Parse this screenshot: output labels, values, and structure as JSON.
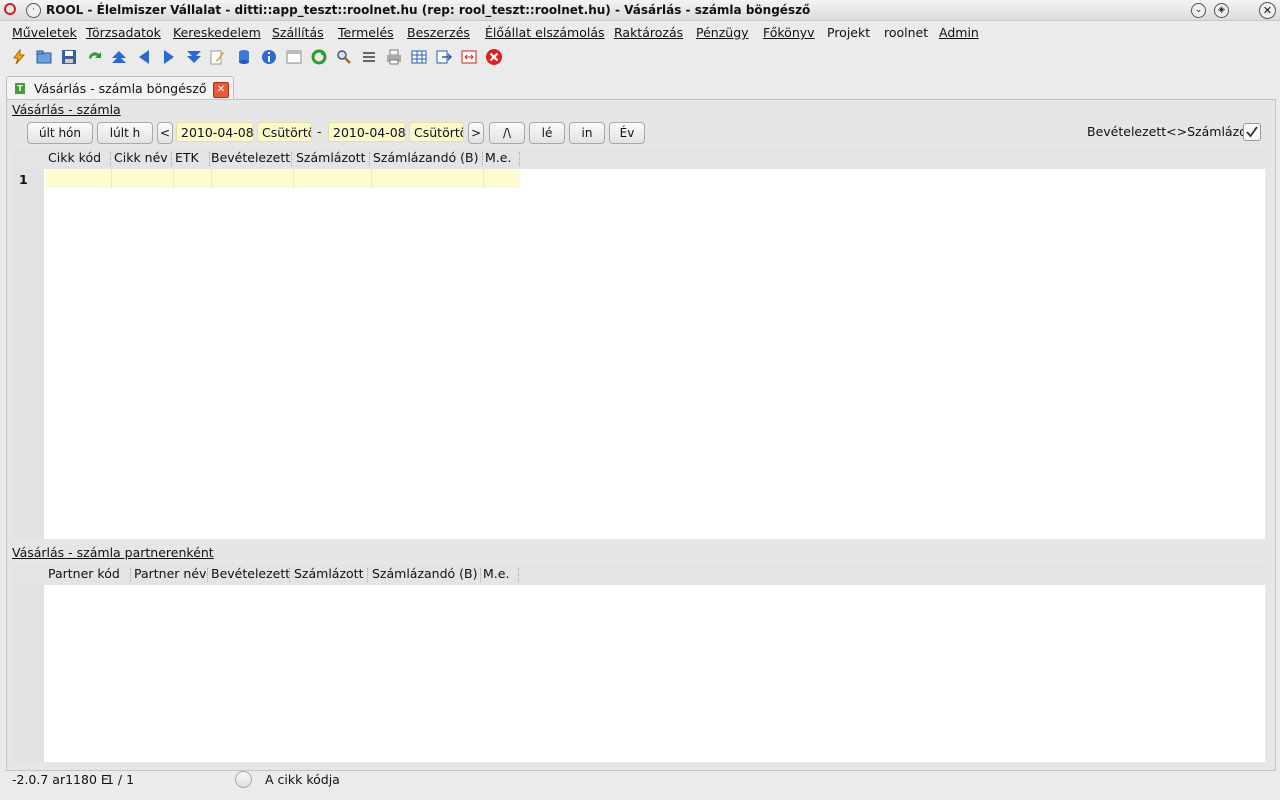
{
  "window": {
    "title": "ROOL - Élelmiszer Vállalat - ditti::app_teszt::roolnet.hu (rep: rool_teszt::roolnet.hu) - Vásárlás - számla böngésző"
  },
  "menu": [
    {
      "label": "Műveletek",
      "underline": "M"
    },
    {
      "label": "Törzsadatok",
      "underline": "T"
    },
    {
      "label": "Kereskedelem",
      "underline": "K"
    },
    {
      "label": "Szállítás",
      "underline": "S"
    },
    {
      "label": "Termelés",
      "underline": "T"
    },
    {
      "label": "Beszerzés",
      "underline": "B"
    },
    {
      "label": "Élőállat elszámolás",
      "underline": "É"
    },
    {
      "label": "Raktározás",
      "underline": "R"
    },
    {
      "label": "Pénzügy",
      "underline": "P"
    },
    {
      "label": "Főkönyv",
      "underline": "F"
    },
    {
      "label": "Projekt",
      "underline": ""
    },
    {
      "label": "roolnet",
      "underline": ""
    },
    {
      "label": "Admin",
      "underline": "A"
    }
  ],
  "toolbar": {
    "icons": [
      "lightning-icon",
      "open-folder-icon",
      "save-icon",
      "refresh-arrow-icon",
      "first-record-icon",
      "previous-record-icon",
      "next-record-icon",
      "last-record-icon",
      "edit-icon",
      "database-icon",
      "info-icon",
      "window-icon",
      "reload-icon",
      "search-icon",
      "list-icon",
      "print-icon",
      "table-icon",
      "export-icon",
      "fullscreen-icon",
      "close-red-icon"
    ]
  },
  "tab": {
    "label": "Vásárlás - számla böngésző",
    "icon_letter": "T"
  },
  "section1": {
    "title": "Vásárlás - számla",
    "buttons": {
      "prev_month": "últ hón",
      "prev_something": "lúlt h",
      "back": "<",
      "forward": ">",
      "b1": "/\\",
      "b2": "lé",
      "b3": "in",
      "b4": "Év"
    },
    "date_from": "2010-04-08",
    "day_from": "Csütörtö",
    "dash": "-",
    "date_to": "2010-04-08",
    "day_to": "Csütörtö",
    "toggle_label": "Bevételezett<>Számlázott",
    "columns": [
      "Cikk kód",
      "Cikk név",
      "ETK",
      "Bevételezett",
      "Számlázott",
      "Számlázandó (B)",
      "M.e."
    ],
    "row_number": "1"
  },
  "section2": {
    "title": "Vásárlás - számla partnerenként",
    "columns": [
      "Partner kód",
      "Partner név",
      "Bevételezett",
      "Számlázott",
      "Számlázandó (B)",
      "M.e."
    ]
  },
  "status": {
    "version": "-2.0.7 ar1180 E",
    "page": "1 / 1",
    "hint": "A cikk kódja"
  },
  "colors": {
    "row_highlight": "#fdfbd2",
    "close_red": "#e02020"
  }
}
